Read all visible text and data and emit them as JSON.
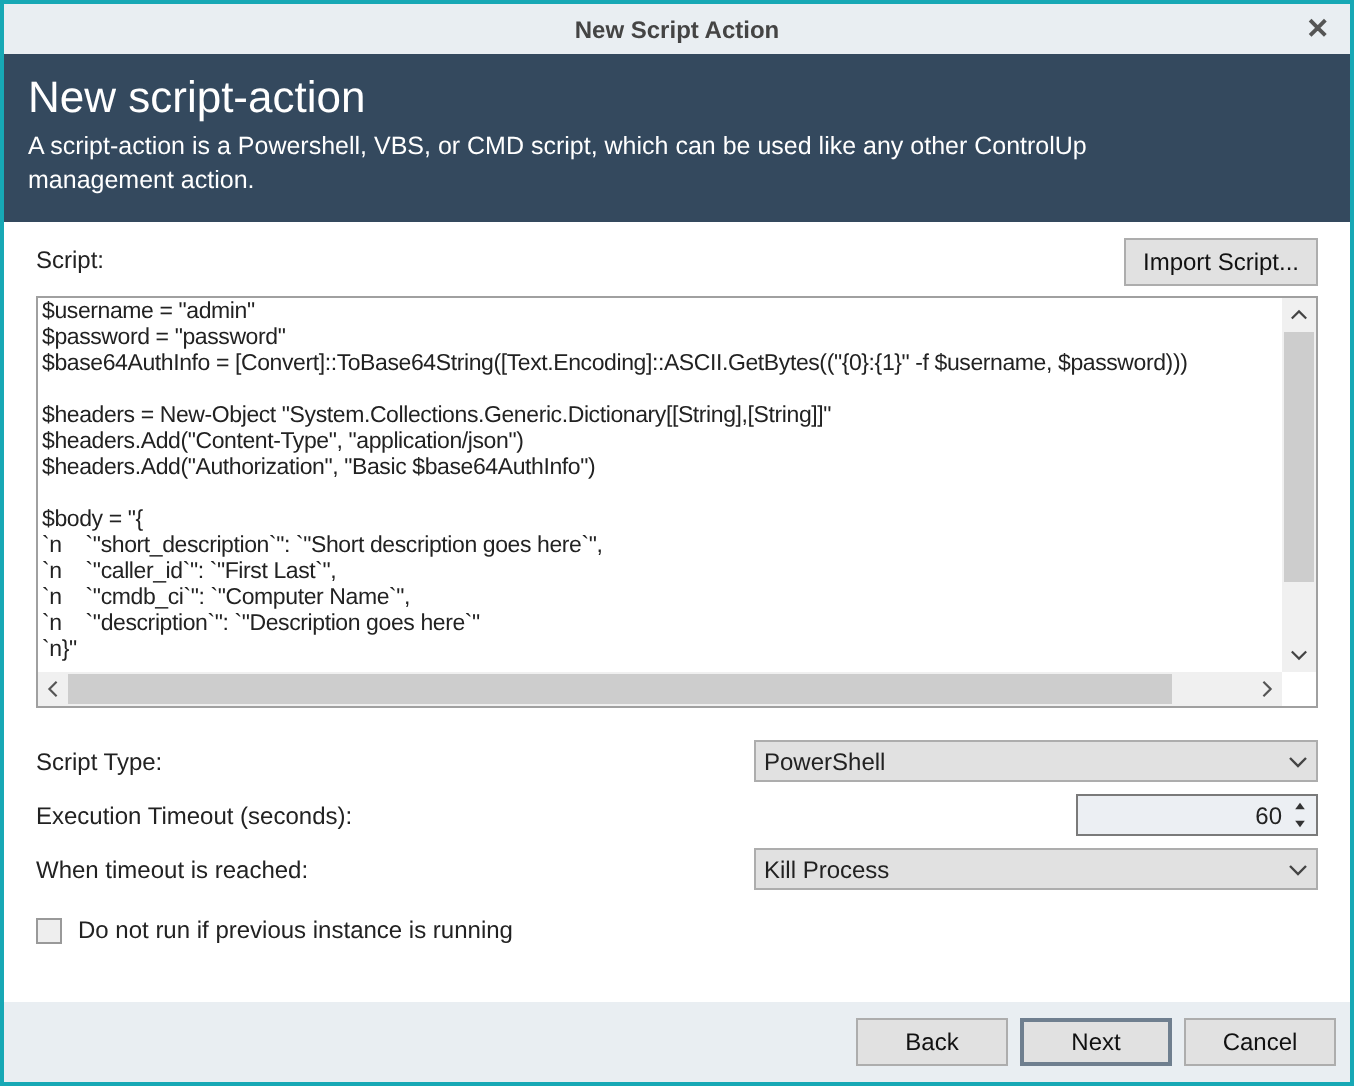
{
  "window": {
    "title": "New Script Action",
    "close": "✕"
  },
  "header": {
    "title": "New script-action",
    "description": "A script-action is a Powershell, VBS, or CMD script, which can be used like any other ControlUp management action."
  },
  "script": {
    "label": "Script:",
    "import_button": "Import Script...",
    "blocks": [
      [
        "$username = \"admin\"",
        "$password = \"password\"",
        "$base64AuthInfo = [Convert]::ToBase64String([Text.Encoding]::ASCII.GetBytes((\"{0}:{1}\" -f $username, $password)))"
      ],
      [
        "$headers = New-Object \"System.Collections.Generic.Dictionary[[String],[String]]\"",
        "$headers.Add(\"Content-Type\", \"application/json\")",
        "$headers.Add(\"Authorization\", \"Basic $base64AuthInfo\")"
      ],
      [
        "$body = \"{",
        "`n    `\"short_description`\": `\"Short description goes here`\",",
        "`n    `\"caller_id`\": `\"First Last`\",",
        "`n    `\"cmdb_ci`\": `\"Computer Name`\",",
        "`n    `\"description`\": `\"Description goes here`\"",
        "`n}\""
      ]
    ]
  },
  "fields": [
    {
      "kind": "select",
      "label": "Script Type:",
      "value": "PowerShell"
    },
    {
      "kind": "spinner",
      "label": "Execution Timeout (seconds):",
      "value": "60"
    },
    {
      "kind": "select",
      "label": "When timeout is reached:",
      "value": "Kill Process"
    }
  ],
  "checkbox": {
    "label": "Do not run if previous instance is running",
    "checked": false
  },
  "buttons": [
    {
      "label": "Back",
      "default": false
    },
    {
      "label": "Next",
      "default": true
    },
    {
      "label": "Cancel",
      "default": false
    }
  ]
}
